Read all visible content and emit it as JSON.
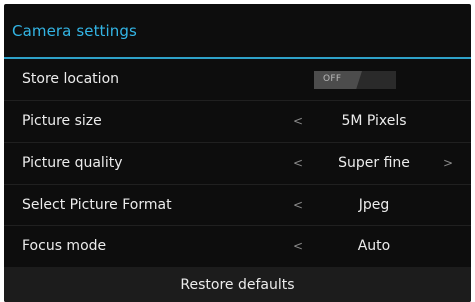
{
  "dialog": {
    "title": "Camera settings",
    "accent_color": "#33b5e5"
  },
  "settings": [
    {
      "label": "Store location",
      "control": "toggle",
      "toggle_text": "OFF",
      "enabled": false
    },
    {
      "label": "Picture size",
      "control": "selector",
      "prev_arrow": "<",
      "value": "5M Pixels",
      "next_arrow": ""
    },
    {
      "label": "Picture quality",
      "control": "selector",
      "prev_arrow": "<",
      "value": "Super fine",
      "next_arrow": ">"
    },
    {
      "label": "Select Picture Format",
      "control": "selector",
      "prev_arrow": "<",
      "value": "Jpeg",
      "next_arrow": ""
    },
    {
      "label": "Focus mode",
      "control": "selector",
      "prev_arrow": "<",
      "value": "Auto",
      "next_arrow": ""
    }
  ],
  "restore_button": {
    "label": "Restore defaults"
  }
}
